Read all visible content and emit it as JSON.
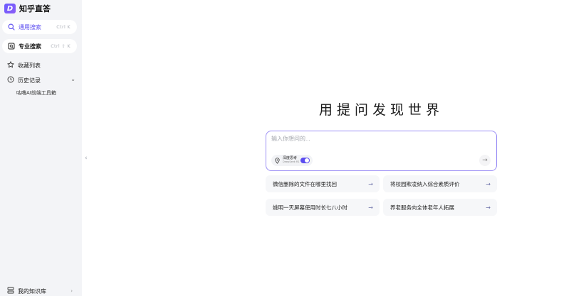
{
  "app": {
    "logo_letter": "D",
    "title": "知乎直答"
  },
  "sidebar": {
    "general_search": {
      "label": "通用搜索",
      "shortcut": "Ctrl  K",
      "icon": "search-icon"
    },
    "pro_search": {
      "label": "专业搜索",
      "shortcut": "Ctrl  ⇧  K",
      "icon": "pro-search-icon"
    },
    "favorites": {
      "label": "收藏列表",
      "icon": "star-icon"
    },
    "history": {
      "label": "历史记录",
      "icon": "clock-icon",
      "entries": [
        "咕噜AI前端工具箱"
      ]
    },
    "knowledge_base": {
      "label": "我的知识库",
      "icon": "library-icon"
    }
  },
  "main": {
    "headline": "用提问发现世界",
    "search": {
      "placeholder": "输入你想问的...",
      "value": ""
    },
    "deep_think": {
      "title": "深度思考",
      "subtitle": "DeepSeek R1",
      "enabled": true
    },
    "send_icon": "arrow-right-icon",
    "suggestions": [
      "微信删除的文件在哪里找回",
      "将校园欺凌纳入综合素质评价",
      "姚明一天屏幕使用时长七八小时",
      "养老服务向全体老年人拓展"
    ]
  },
  "colors": {
    "accent": "#5b4cf0",
    "sidebar_bg": "#f3f4f7",
    "search_border": "#9c8ff5"
  }
}
